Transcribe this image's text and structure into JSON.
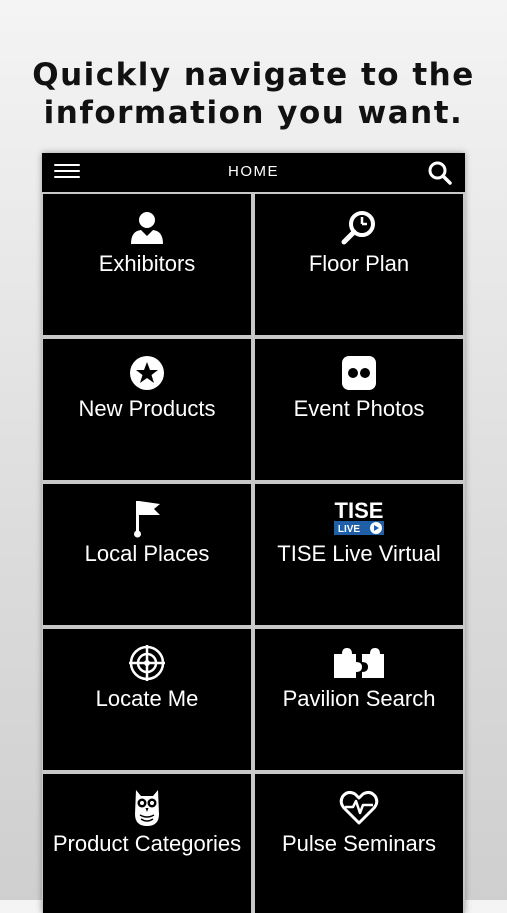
{
  "promo": {
    "line1": "Quickly navigate to the",
    "line2": "information you want."
  },
  "nav": {
    "title": "HOME",
    "menu_icon": "hamburger-menu-icon",
    "search_icon": "search-icon"
  },
  "tiles": [
    {
      "label": "Exhibitors",
      "icon": "person-icon"
    },
    {
      "label": "Floor Plan",
      "icon": "map-search-icon"
    },
    {
      "label": "New Products",
      "icon": "star-circle-icon"
    },
    {
      "label": "Event Photos",
      "icon": "photos-icon"
    },
    {
      "label": "Local Places",
      "icon": "flag-icon"
    },
    {
      "label": "TISE Live Virtual",
      "icon": "tise-live-logo",
      "logo_text": "TISE",
      "logo_sub": "LIVE"
    },
    {
      "label": "Locate Me",
      "icon": "target-icon"
    },
    {
      "label": "Pavilion Search",
      "icon": "puzzle-icon"
    },
    {
      "label": "Product Categories",
      "icon": "owl-icon"
    },
    {
      "label": "Pulse Seminars",
      "icon": "heart-pulse-icon"
    }
  ],
  "colors": {
    "tile_bg": "#000000",
    "tile_border": "#c8c8c8",
    "text": "#ffffff",
    "logo_blue": "#1f5fa8"
  }
}
